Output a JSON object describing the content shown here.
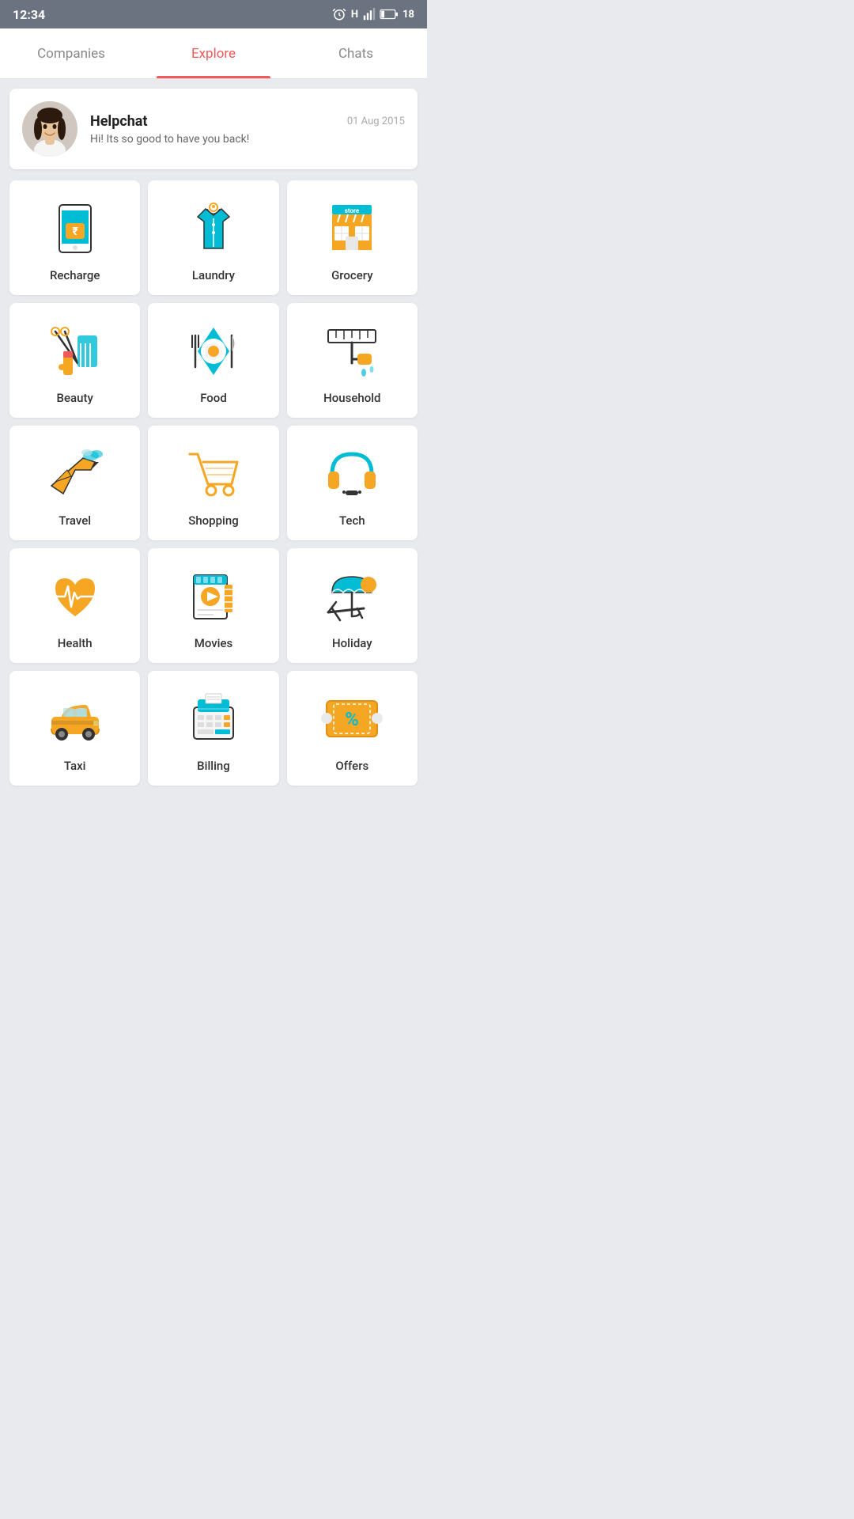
{
  "statusBar": {
    "time": "12:34",
    "batteryLevel": "18"
  },
  "navTabs": [
    {
      "id": "companies",
      "label": "Companies",
      "active": false
    },
    {
      "id": "explore",
      "label": "Explore",
      "active": true
    },
    {
      "id": "chats",
      "label": "Chats",
      "active": false
    }
  ],
  "chatCard": {
    "name": "Helpchat",
    "date": "01 Aug 2015",
    "message": "Hi! Its so good to have you back!"
  },
  "gridItems": [
    {
      "id": "recharge",
      "label": "Recharge"
    },
    {
      "id": "laundry",
      "label": "Laundry"
    },
    {
      "id": "grocery",
      "label": "Grocery"
    },
    {
      "id": "beauty",
      "label": "Beauty"
    },
    {
      "id": "food",
      "label": "Food"
    },
    {
      "id": "household",
      "label": "Household"
    },
    {
      "id": "travel",
      "label": "Travel"
    },
    {
      "id": "shopping",
      "label": "Shopping"
    },
    {
      "id": "tech",
      "label": "Tech"
    },
    {
      "id": "health",
      "label": "Health"
    },
    {
      "id": "movies",
      "label": "Movies"
    },
    {
      "id": "holiday",
      "label": "Holiday"
    },
    {
      "id": "taxi",
      "label": "Taxi"
    },
    {
      "id": "billing",
      "label": "Billing"
    },
    {
      "id": "offers",
      "label": "Offers"
    }
  ],
  "colors": {
    "teal": "#00bcd4",
    "orange": "#f5a623",
    "red": "#f05a5a",
    "darkLine": "#333",
    "lightGray": "#e0e0e0"
  }
}
